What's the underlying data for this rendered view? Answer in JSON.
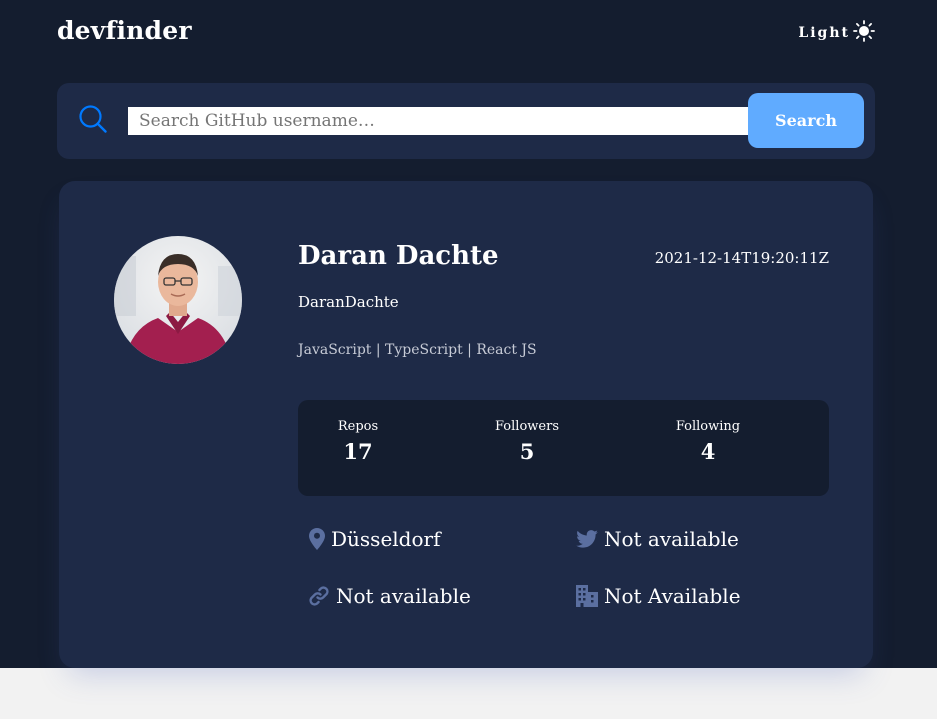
{
  "header": {
    "logo": "devfinder",
    "theme_toggle_label": "Light",
    "theme_icon": "sun-icon"
  },
  "search": {
    "icon": "search-icon",
    "placeholder": "Search GitHub username…",
    "value": "",
    "button_label": "Search"
  },
  "profile": {
    "avatar_icon": "avatar",
    "name": "Daran Dachte",
    "joined": "2021-12-14T19:20:11Z",
    "login": "DaranDachte",
    "bio": "JavaScript | TypeScript | React JS",
    "stats": {
      "repos_label": "Repos",
      "repos_value": "17",
      "followers_label": "Followers",
      "followers_value": "5",
      "following_label": "Following",
      "following_value": "4"
    },
    "info": {
      "location": "Düsseldorf",
      "twitter": "Not available",
      "blog": "Not available",
      "company": "Not Available"
    }
  },
  "colors": {
    "background": "#141d2f",
    "card": "#1e2a47",
    "accent": "#60abff",
    "icon_muted": "#5b6fa0"
  }
}
